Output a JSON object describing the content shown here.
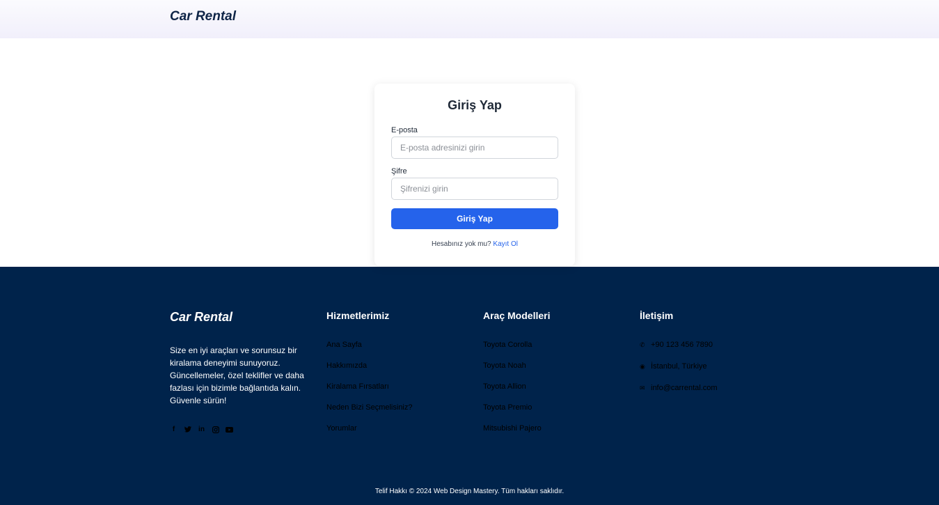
{
  "header": {
    "brand": "Car Rental"
  },
  "login": {
    "title": "Giriş Yap",
    "email_label": "E-posta",
    "email_placeholder": "E-posta adresinizi girin",
    "password_label": "Şifre",
    "password_placeholder": "Şifrenizi girin",
    "submit_label": "Giriş Yap",
    "no_account_text": "Hesabınız yok mu?",
    "signup_link": "Kayıt Ol"
  },
  "footer": {
    "brand": "Car Rental",
    "description": "Size en iyi araçları ve sorunsuz bir kiralama deneyimi sunuyoruz. Güncellemeler, özel teklifler ve daha fazlası için bizimle bağlantıda kalın. Güvenle sürün!",
    "socials": [
      "facebook-icon",
      "twitter-icon",
      "linkedin-icon",
      "instagram-icon",
      "youtube-icon"
    ],
    "services": {
      "title": "Hizmetlerimiz",
      "items": [
        "Ana Sayfa",
        "Hakkımızda",
        "Kiralama Fırsatları",
        "Neden Bizi Seçmelisiniz?",
        "Yorumlar"
      ]
    },
    "models": {
      "title": "Araç Modelleri",
      "items": [
        "Toyota Corolla",
        "Toyota Noah",
        "Toyota Allion",
        "Toyota Premio",
        "Mitsubishi Pajero"
      ]
    },
    "contact": {
      "title": "İletişim",
      "phone": "+90 123 456 7890",
      "address": "İstanbul, Türkiye",
      "email": "info@carrental.com"
    },
    "copyright": "Telif Hakkı © 2024 Web Design Mastery. Tüm hakları saklıdır."
  },
  "colors": {
    "accent": "#2563eb",
    "footer_bg": "#00234b",
    "brand": "#0f2547"
  }
}
